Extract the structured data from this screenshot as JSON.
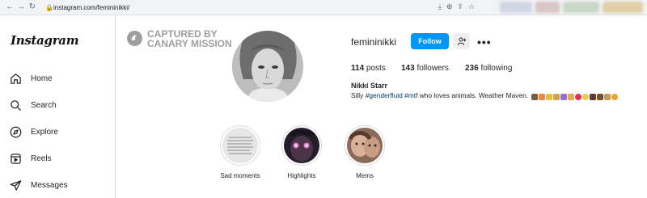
{
  "browser": {
    "back_icon": "←",
    "forward_icon": "→",
    "reload_icon": "↻",
    "url": "instagram.com/femininikki/"
  },
  "sidebar": {
    "logo": "Instagram",
    "items": [
      {
        "label": "Home",
        "icon": "home-icon"
      },
      {
        "label": "Search",
        "icon": "search-icon"
      },
      {
        "label": "Explore",
        "icon": "compass-icon"
      },
      {
        "label": "Reels",
        "icon": "reels-icon"
      },
      {
        "label": "Messages",
        "icon": "messages-icon"
      }
    ]
  },
  "watermark": {
    "line1": "CAPTURED BY",
    "line2": "CANARY MISSION"
  },
  "profile": {
    "username": "femininikki",
    "follow_label": "Follow",
    "more": "•••",
    "stats": {
      "posts_count": "114",
      "posts_label": "posts",
      "followers_count": "143",
      "followers_label": "followers",
      "following_count": "236",
      "following_label": "following"
    },
    "full_name": "Nikki Starr",
    "bio_prefix": "Silly ",
    "bio_tag1": "#genderfluid",
    "bio_space": " ",
    "bio_tag2": "#mtf",
    "bio_suffix": " who loves animals. Weather Maven. "
  },
  "highlights": [
    {
      "label": "Sad moments"
    },
    {
      "label": "Highlights"
    },
    {
      "label": "Mems"
    }
  ],
  "colors": {
    "accent": "#0095f6",
    "hashtag": "#00376b",
    "watermark": "#9e9e9e"
  }
}
